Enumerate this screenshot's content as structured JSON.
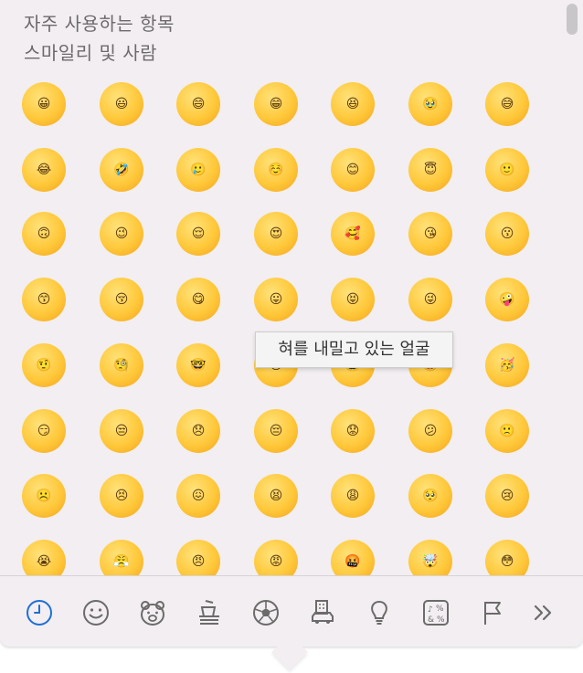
{
  "sections": {
    "frequent_title": "자주 사용하는 항목",
    "smileys_title": "스마일리 및 사람"
  },
  "tooltip": {
    "text": "혀를 내밀고 있는 얼굴"
  },
  "emoji_rows": [
    [
      "😀",
      "😃",
      "😄",
      "😁",
      "😆",
      "🥹",
      "😅"
    ],
    [
      "😂",
      "🤣",
      "🥲",
      "☺️",
      "😊",
      "😇",
      "🙂"
    ],
    [
      "🙃",
      "😉",
      "😌",
      "😍",
      "🥰",
      "😘",
      "😗"
    ],
    [
      "😙",
      "😚",
      "😋",
      "😛",
      "😝",
      "😜",
      "🤪"
    ],
    [
      "🤨",
      "🧐",
      "🤓",
      "😎",
      "🥸",
      "🤩",
      "🥳"
    ],
    [
      "😏",
      "😒",
      "😞",
      "😔",
      "😟",
      "😕",
      "🙁"
    ],
    [
      "☹️",
      "😣",
      "😖",
      "😫",
      "😩",
      "🥺",
      "😢"
    ],
    [
      "😭",
      "😤",
      "😠",
      "😡",
      "🤬",
      "🤯",
      "😳"
    ]
  ],
  "categories": [
    {
      "name": "recent",
      "icon": "clock-icon",
      "active": true
    },
    {
      "name": "smileys",
      "icon": "smiley-icon"
    },
    {
      "name": "animals",
      "icon": "bear-icon"
    },
    {
      "name": "food",
      "icon": "food-icon"
    },
    {
      "name": "activity",
      "icon": "soccer-ball-icon"
    },
    {
      "name": "travel",
      "icon": "building-car-icon"
    },
    {
      "name": "objects",
      "icon": "lightbulb-icon"
    },
    {
      "name": "symbols",
      "icon": "symbols-icon"
    },
    {
      "name": "flags",
      "icon": "flag-icon"
    },
    {
      "name": "more",
      "icon": "double-chevron-right-icon"
    }
  ],
  "colors": {
    "accent": "#1f6fd6",
    "icon_gray": "#6b6b6b"
  }
}
